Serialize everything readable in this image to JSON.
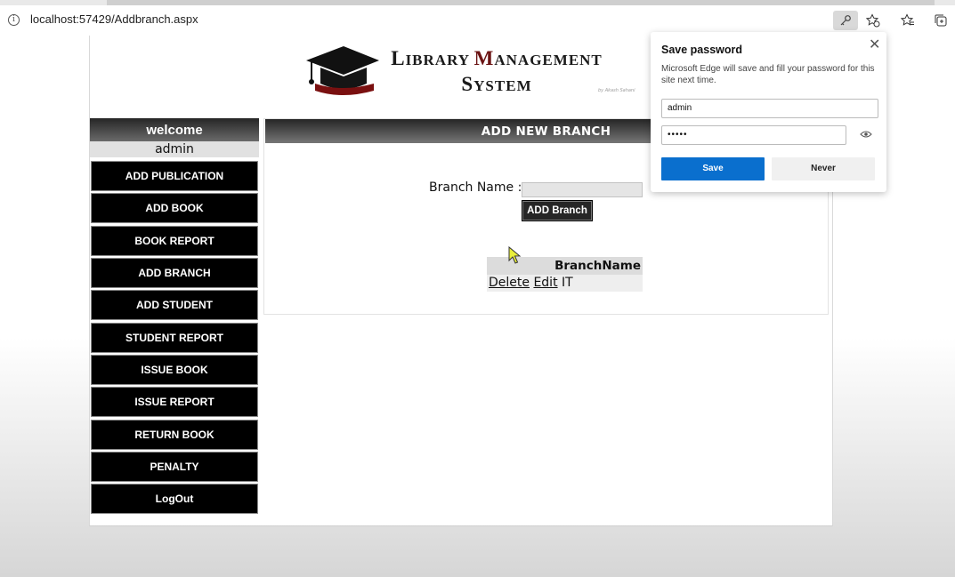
{
  "browser": {
    "url": "localhost:57429/Addbranch.aspx",
    "icons": [
      "info-icon",
      "key-icon",
      "favorite-add-icon",
      "favorites-icon",
      "collections-icon"
    ]
  },
  "header": {
    "title_line1": [
      "L",
      "IBRARY ",
      "M",
      "ANAGEMENT"
    ],
    "title_line2": [
      "S",
      "YSTEM"
    ],
    "logo": "graduation-cap-logo",
    "author_mark": "by Akash Sahani",
    "accent_color": "#6b1414"
  },
  "sidebar": {
    "welcome": "welcome",
    "user": "admin",
    "items": [
      {
        "label": "ADD PUBLICATION"
      },
      {
        "label": "ADD BOOK"
      },
      {
        "label": "BOOK REPORT"
      },
      {
        "label": "ADD BRANCH"
      },
      {
        "label": "ADD STUDENT"
      },
      {
        "label": "STUDENT REPORT"
      },
      {
        "label": "ISSUE BOOK"
      },
      {
        "label": "ISSUE REPORT"
      },
      {
        "label": "RETURN BOOK"
      },
      {
        "label": "PENALTY"
      },
      {
        "label": "LogOut"
      }
    ]
  },
  "main": {
    "heading": "ADD NEW BRANCH",
    "branch_label": "Branch Name :",
    "branch_value": "",
    "add_button": "ADD Branch",
    "grid": {
      "column": "BranchName",
      "rows": [
        {
          "delete": "Delete",
          "edit": "Edit",
          "name": "IT"
        }
      ]
    }
  },
  "password_popup": {
    "title": "Save password",
    "description": "Microsoft Edge will save and fill your password for this site next time.",
    "username": "admin",
    "password_mask": "•••••",
    "save_label": "Save",
    "never_label": "Never",
    "save_color": "#0a6fce"
  }
}
